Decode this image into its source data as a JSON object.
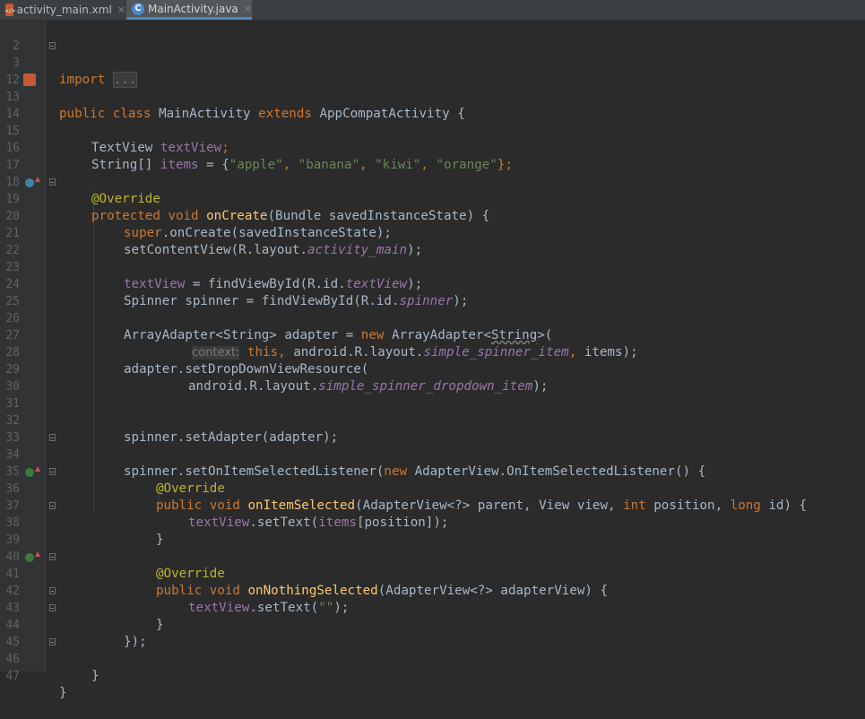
{
  "tabs": [
    {
      "label": "activity_main.xml",
      "icon": "xml-file-icon",
      "active": false
    },
    {
      "label": "MainActivity.java",
      "icon": "java-class-icon",
      "active": true
    }
  ],
  "close_glyph": "×",
  "lines": [
    {
      "n": "2"
    },
    {
      "n": "3"
    },
    {
      "n": "12"
    },
    {
      "n": "13"
    },
    {
      "n": "14"
    },
    {
      "n": "15"
    },
    {
      "n": "16"
    },
    {
      "n": "17"
    },
    {
      "n": "18"
    },
    {
      "n": "19"
    },
    {
      "n": "20"
    },
    {
      "n": "21"
    },
    {
      "n": "22"
    },
    {
      "n": "23"
    },
    {
      "n": "24"
    },
    {
      "n": "25"
    },
    {
      "n": "26"
    },
    {
      "n": "27"
    },
    {
      "n": "28"
    },
    {
      "n": "29"
    },
    {
      "n": "30"
    },
    {
      "n": "31"
    },
    {
      "n": "32"
    },
    {
      "n": "33"
    },
    {
      "n": "34"
    },
    {
      "n": "35"
    },
    {
      "n": "36"
    },
    {
      "n": "37"
    },
    {
      "n": "38"
    },
    {
      "n": "39"
    },
    {
      "n": "40"
    },
    {
      "n": "41"
    },
    {
      "n": "42"
    },
    {
      "n": "43"
    },
    {
      "n": "44"
    },
    {
      "n": "45"
    },
    {
      "n": "46"
    },
    {
      "n": "47"
    }
  ],
  "code": {
    "import_kw": "import",
    "import_fold": "...",
    "public": "public",
    "class": "class",
    "class_name": "MainActivity",
    "extends": "extends",
    "super_class": "AppCompatActivity",
    "open_brace": "{",
    "textview_type": "TextView",
    "textview_field": "textView",
    "semicolon": ";",
    "string_arr": "String[]",
    "items_field": "items",
    "assign_open": " = {",
    "s_apple": "\"apple\"",
    "s_banana": "\"banana\"",
    "s_kiwi": "\"kiwi\"",
    "s_orange": "\"orange\"",
    "comma": ", ",
    "close_semi": "};",
    "override": "@Override",
    "protected": "protected",
    "void": "void",
    "oncreate": "onCreate",
    "oncreate_params": "(Bundle savedInstanceState) {",
    "super_kw": "super",
    "super_call": ".onCreate(savedInstanceState);",
    "setcontentview": "setContentView(R.layout.",
    "activity_main": "activity_main",
    "close_paren_semi": ");",
    "textview_assign": " = findViewById(R.id.",
    "textview_id": "textView",
    "spinner_decl": "Spinner spinner = findViewById(R.id.",
    "spinner_id": "spinner",
    "adapter_decl": "ArrayAdapter<String> adapter = ",
    "new_kw": "new",
    "arrayadapter_new": " ArrayAdapter<",
    "string_generic": "String",
    "gt_paren": ">(",
    "context_hint": "context:",
    "this_kw": "this",
    "android_layout": "android.R.layout.",
    "simple_item": "simple_spinner_item",
    "items_arg": "items",
    "setdropdown": "adapter.setDropDownViewResource(",
    "simple_dropdown": "simple_spinner_dropdown_item",
    "setadapter": "spinner.setAdapter(adapter);",
    "setlistener": "spinner.setOnItemSelectedListener(",
    "listener_class": " AdapterView.OnItemSelectedListener() {",
    "onitemselected": "onItemSelected",
    "onitemselected_params_a": "(AdapterView<?> parent, View view, ",
    "int_kw": "int",
    "position_param": " position, ",
    "long_kw": "long",
    "id_param": " id) {",
    "settext_a": ".setText(",
    "items_pos": "[position]);",
    "close_brace": "}",
    "onnothing": "onNothingSelected",
    "onnothing_params": "(AdapterView<?> adapterView) {",
    "empty_str": "\"\"",
    "close_listener": "});"
  }
}
